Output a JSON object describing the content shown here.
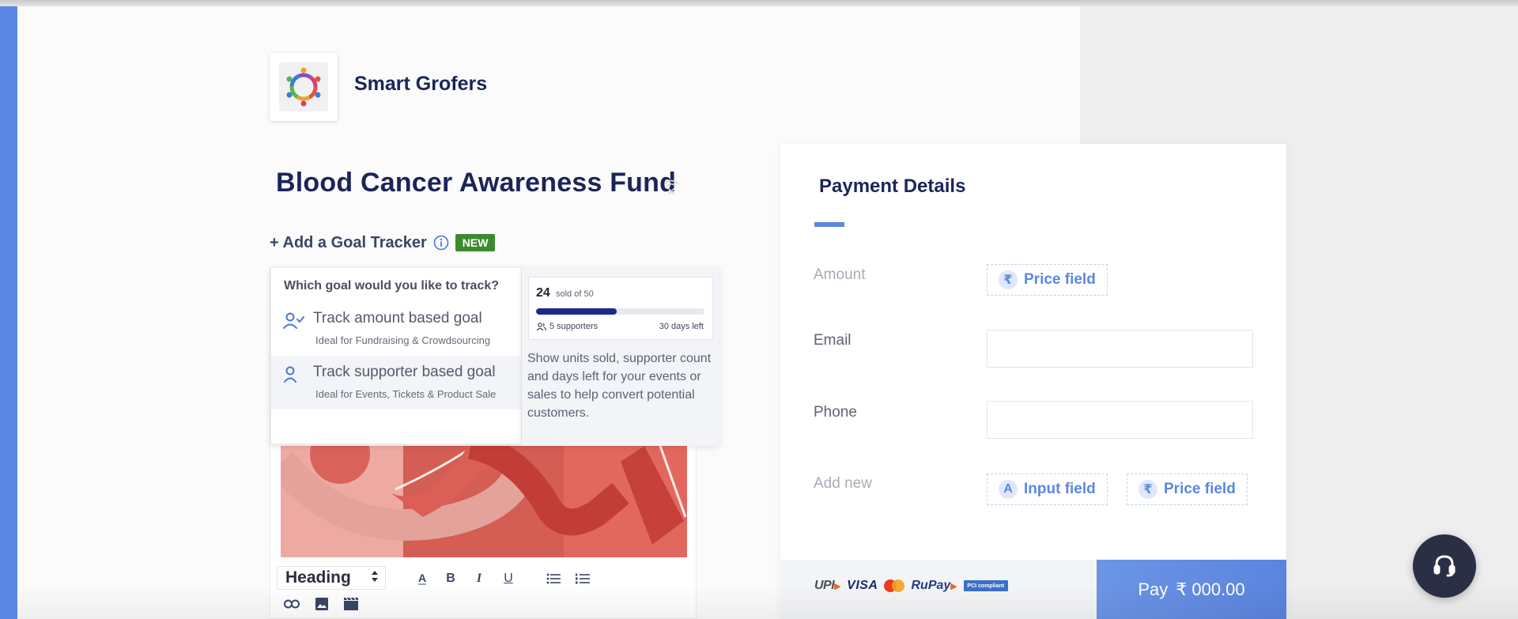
{
  "org": {
    "name": "Smart Grofers",
    "logo_icon": "community-circle-logo"
  },
  "campaign": {
    "title": "Blood Cancer Awareness Fund",
    "status_icon": "wifi-off-icon"
  },
  "goal_tracker": {
    "add_label": "+ Add a Goal Tracker",
    "info_icon": "info-icon",
    "badge": "NEW",
    "popover": {
      "question": "Which goal would you like to track?",
      "options": [
        {
          "title": "Track amount based goal",
          "subtitle": "Ideal for Fundraising & Crowdsourcing",
          "icon": "user-check-icon"
        },
        {
          "title": "Track supporter based goal",
          "subtitle": "Ideal for Events, Tickets & Product Sale",
          "icon": "user-icon",
          "highlighted": true
        }
      ]
    },
    "preview": {
      "count": "24",
      "sold_label": "sold of 50",
      "sold": 24,
      "total": 50,
      "supporters": "5 supporters",
      "days_left": "30 days left",
      "description": "Show units sold, supporter count and days left for your events or sales to help convert potential customers."
    }
  },
  "editor": {
    "block_type": "Heading",
    "tools": [
      "text-color",
      "bold",
      "italic",
      "underline",
      "bullet-list",
      "numbered-list",
      "link",
      "image",
      "video"
    ],
    "labels": {
      "text_color": "A",
      "bold": "B",
      "italic": "I",
      "underline": "U"
    }
  },
  "payment": {
    "title": "Payment Details",
    "accent": "#5b87e2",
    "fields": {
      "amount_label": "Amount",
      "amount_chip": "Price field",
      "email_label": "Email",
      "email_value": "",
      "phone_label": "Phone",
      "phone_value": "",
      "add_new_label": "Add new",
      "add_input_chip": "Input field",
      "add_price_chip": "Price field"
    },
    "chip_badges": {
      "rupee": "₹",
      "text": "A"
    },
    "methods": {
      "upi": "UPI",
      "visa": "VISA",
      "rupay": "RuPay",
      "pci": "PCI compliant"
    },
    "pay_button": {
      "label": "Pay",
      "amount": "₹ 000.00"
    }
  },
  "support": {
    "icon": "headset-icon"
  }
}
